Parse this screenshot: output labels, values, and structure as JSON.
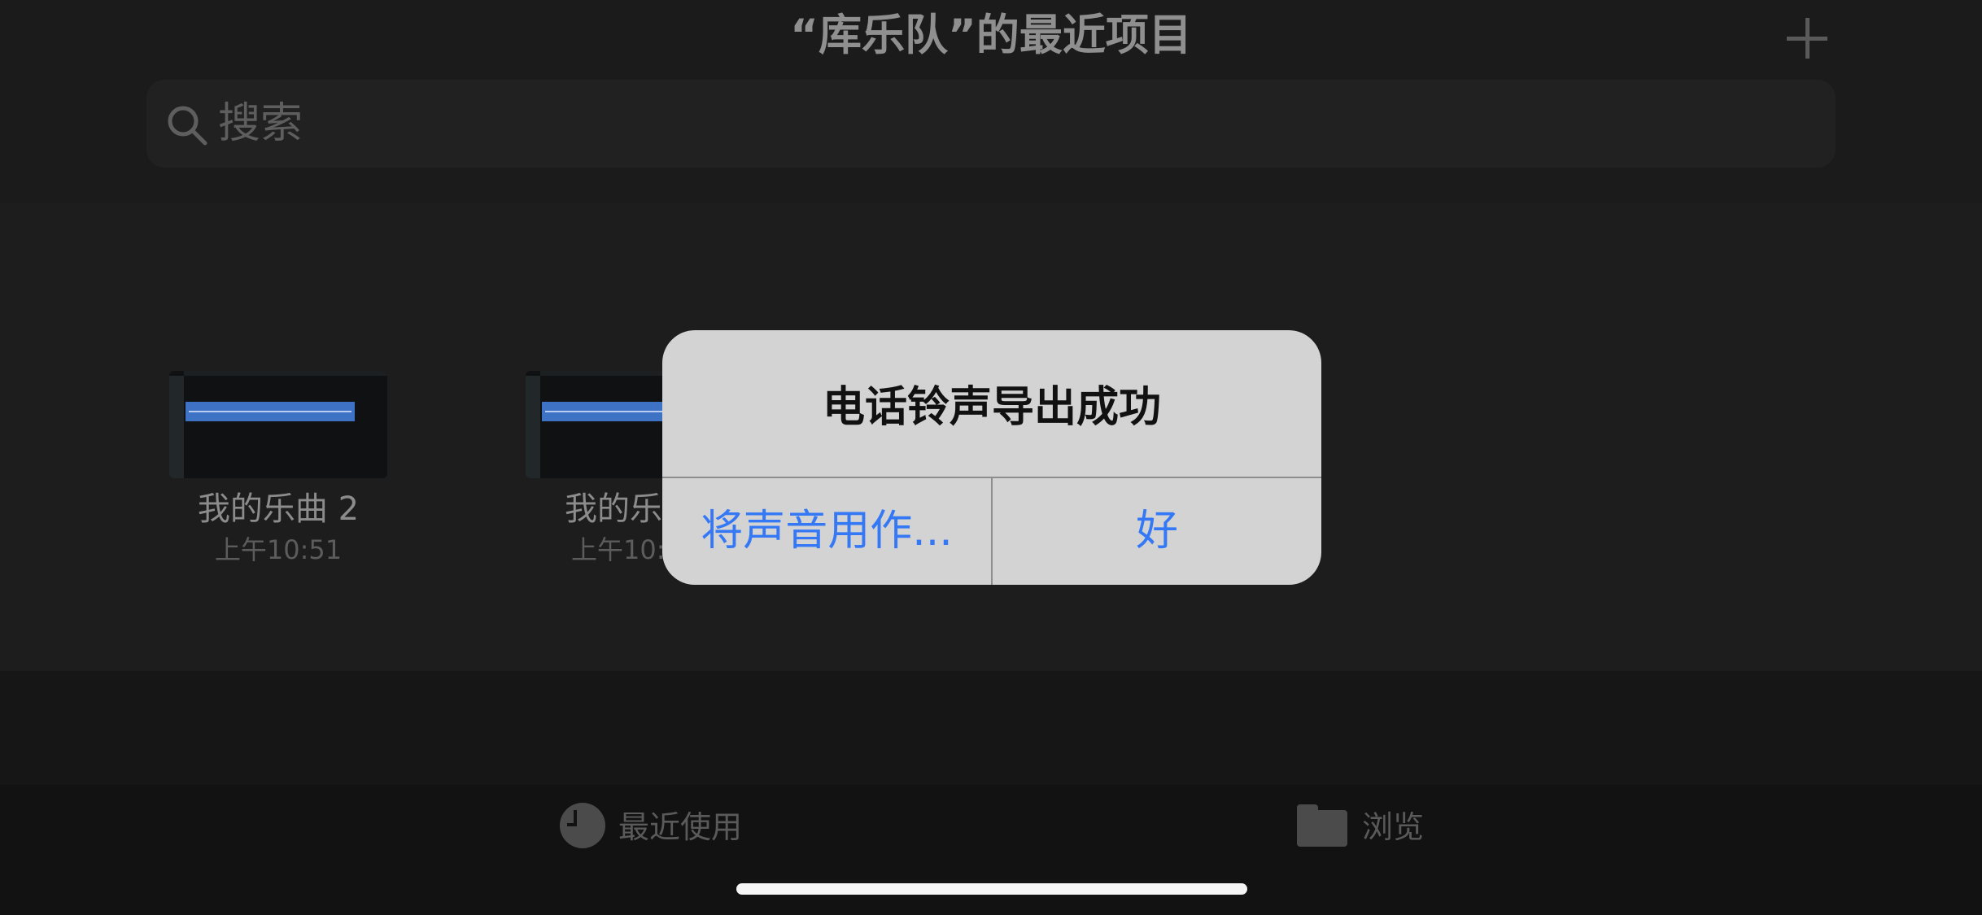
{
  "header": {
    "title": "“库乐队”的最近项目",
    "add_icon": "plus-icon"
  },
  "search": {
    "placeholder": "搜索",
    "icon": "search-icon"
  },
  "projects": [
    {
      "name": "我的乐曲 2",
      "date": "上午10:51"
    },
    {
      "name": "我的乐",
      "date": "上午10:"
    }
  ],
  "alert": {
    "title": "电话铃声导出成功",
    "buttons": [
      {
        "label": "将声音用作..."
      },
      {
        "label": "好"
      }
    ]
  },
  "tab_bar": {
    "tabs": [
      {
        "label": "最近使用",
        "icon": "clock-icon"
      },
      {
        "label": "浏览",
        "icon": "folder-icon"
      }
    ]
  },
  "colors": {
    "background": "#161616",
    "alert_background": "#d3d3d3",
    "accent": "#3478f6",
    "region": "#3e72c4"
  }
}
